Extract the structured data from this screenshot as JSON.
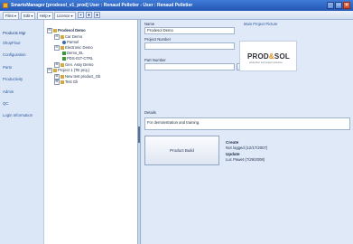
{
  "window": {
    "title": "SmartoManager   [prodesol_v1_prod]   User : Renaud Pelletier - User : Renaud Pelletier",
    "minimize": "_",
    "maximize": "□",
    "close": "×"
  },
  "menubar": {
    "files": "Files ▾",
    "edit": "Edit ▾",
    "help": "Help ▾",
    "licence": "Licence ▾",
    "tools": [
      "▪",
      "♦",
      "♦"
    ]
  },
  "leftnav": {
    "items": [
      "Products Mgr",
      "ShopFloor",
      "Configuration",
      "Parts",
      "Productivity",
      "Admin",
      "QC",
      "Login Information"
    ]
  },
  "tree": {
    "nodes": [
      {
        "text": "Prodesol Demo",
        "exp": "⊟"
      },
      {
        "text": "Car Demo",
        "exp": "⊟"
      },
      {
        "text": "Parmel",
        "exp": ""
      },
      {
        "text": "Electronic Demo",
        "exp": "⊟"
      },
      {
        "text": "Demo_EL",
        "exp": ""
      },
      {
        "text": "PDS-01T-CTRL",
        "exp": ""
      },
      {
        "text": "Gen. Assy Demo",
        "exp": "⊞"
      },
      {
        "text": "Project 1 (Tst proj.)",
        "exp": "⊟"
      },
      {
        "text": "New test product_Gb",
        "exp": "⊞"
      },
      {
        "text": "Test Gli",
        "exp": "⊞"
      }
    ]
  },
  "detail": {
    "name_label": "Name",
    "name_value": "Prodesol Demo",
    "project_number_label": "Project Number",
    "project_number_value": "",
    "part_number_label": "Part Number",
    "part_number_value": "",
    "browse_button": "...",
    "clear_button": "Clear",
    "picture_label": "Main Project Picture",
    "logo_text_a": "PROD",
    "logo_text_b": "&",
    "logo_text_c": "SOL",
    "logo_subtitle": "production and project solutions",
    "details_label": "Details",
    "details_value": "For demonstration and training.",
    "build_button": "Product Build",
    "create_heading": "Create",
    "create_value": "Not logged (12/17/2007)",
    "update_heading": "Update",
    "update_value": "Luc Pawet (7/29/2008)"
  },
  "colors": {
    "titlebar": "#2356b2",
    "nav_link": "#2b58a0",
    "logo_accent": "#e08a18"
  }
}
